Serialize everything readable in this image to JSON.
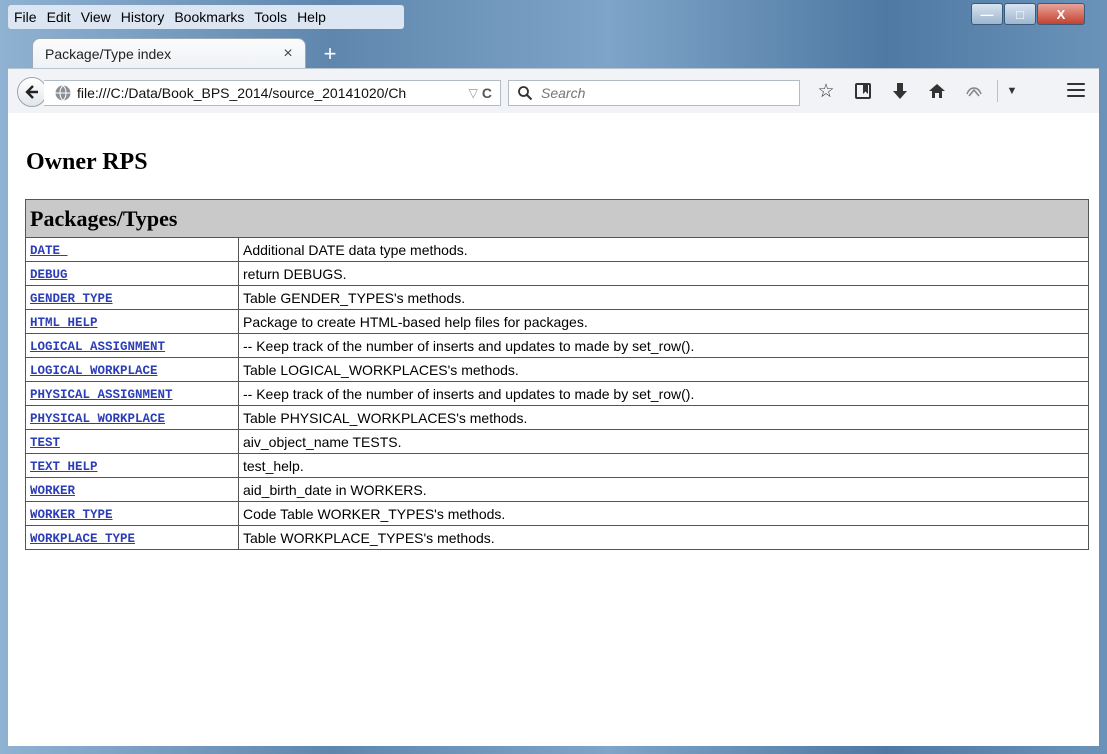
{
  "menu": [
    "File",
    "Edit",
    "View",
    "History",
    "Bookmarks",
    "Tools",
    "Help"
  ],
  "window_controls": {
    "minimize": "—",
    "maximize": "□",
    "close": "X"
  },
  "tab": {
    "title": "Package/Type index",
    "close": "×",
    "new": "+"
  },
  "nav": {
    "url": "file:///C:/Data/Book_BPS_2014/source_20141020/Ch",
    "search_placeholder": "Search"
  },
  "icons": {
    "back": "back-arrow-icon",
    "globe": "globe-icon",
    "dropdown": "dropdown-triangle-icon",
    "reload": "reload-icon",
    "search": "search-icon",
    "bookmark": "star-icon",
    "reading_list": "bookmark-list-icon",
    "downloads": "download-arrow-icon",
    "home": "home-icon",
    "addon": "addon-icon",
    "menu": "hamburger-menu-icon"
  },
  "page": {
    "title": "Owner RPS",
    "table_header": "Packages/Types",
    "rows": [
      {
        "name": "DATE_",
        "desc": "Additional DATE data type methods."
      },
      {
        "name": "DEBUG",
        "desc": "return DEBUGS."
      },
      {
        "name": "GENDER_TYPE",
        "desc": "Table GENDER_TYPES's methods."
      },
      {
        "name": "HTML_HELP",
        "desc": "Package to create HTML-based help files for packages."
      },
      {
        "name": "LOGICAL_ASSIGNMENT",
        "desc": "-- Keep track of the number of inserts and updates to made by set_row()."
      },
      {
        "name": "LOGICAL_WORKPLACE",
        "desc": "Table LOGICAL_WORKPLACES's methods."
      },
      {
        "name": "PHYSICAL_ASSIGNMENT",
        "desc": "-- Keep track of the number of inserts and updates to made by set_row()."
      },
      {
        "name": "PHYSICAL_WORKPLACE",
        "desc": "Table PHYSICAL_WORKPLACES's methods."
      },
      {
        "name": "TEST",
        "desc": "aiv_object_name TESTS."
      },
      {
        "name": "TEXT_HELP",
        "desc": "test_help."
      },
      {
        "name": "WORKER",
        "desc": "aid_birth_date in WORKERS."
      },
      {
        "name": "WORKER_TYPE",
        "desc": "Code Table WORKER_TYPES's methods."
      },
      {
        "name": "WORKPLACE_TYPE",
        "desc": "Table WORKPLACE_TYPES's methods."
      }
    ]
  },
  "colors": {
    "link": "#2b3eb8",
    "table_header_bg": "#c9c9c9"
  }
}
